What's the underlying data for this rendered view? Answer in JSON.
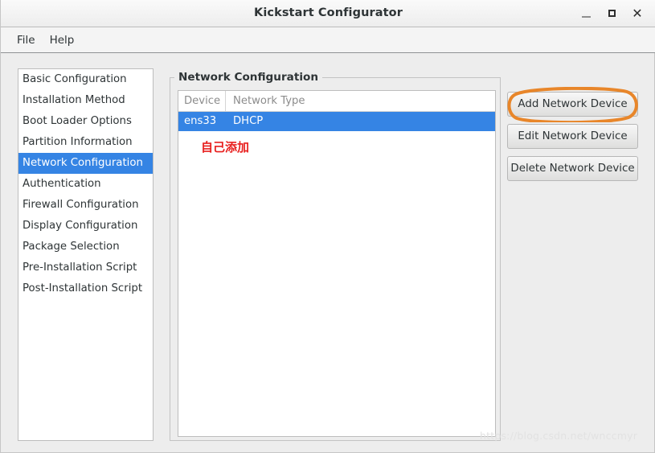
{
  "window": {
    "title": "Kickstart Configurator",
    "controls": {
      "minimize": "minimize-icon",
      "maximize": "maximize-icon",
      "close": "close-icon"
    }
  },
  "menubar": {
    "items": [
      {
        "label": "File"
      },
      {
        "label": "Help"
      }
    ]
  },
  "sidebar": {
    "items": [
      {
        "label": "Basic Configuration",
        "selected": false
      },
      {
        "label": "Installation Method",
        "selected": false
      },
      {
        "label": "Boot Loader Options",
        "selected": false
      },
      {
        "label": "Partition Information",
        "selected": false
      },
      {
        "label": "Network Configuration",
        "selected": true
      },
      {
        "label": "Authentication",
        "selected": false
      },
      {
        "label": "Firewall Configuration",
        "selected": false
      },
      {
        "label": "Display Configuration",
        "selected": false
      },
      {
        "label": "Package Selection",
        "selected": false
      },
      {
        "label": "Pre-Installation Script",
        "selected": false
      },
      {
        "label": "Post-Installation Script",
        "selected": false
      }
    ]
  },
  "main": {
    "group_title": "Network Configuration",
    "table": {
      "columns": [
        "Device",
        "Network Type"
      ],
      "rows": [
        {
          "device": "ens33",
          "network_type": "DHCP",
          "selected": true
        }
      ]
    },
    "annotation": "自己添加",
    "buttons": [
      {
        "label": "Add Network Device",
        "highlighted": true
      },
      {
        "label": "Edit Network Device",
        "highlighted": false
      },
      {
        "label": "Delete Network Device",
        "highlighted": false
      }
    ]
  },
  "watermark": "https://blog.csdn.net/wnccmyr",
  "colors": {
    "selection_blue": "#3584e4",
    "annotation_red": "#e8201f",
    "highlight_orange": "#e8862a",
    "window_background": "#ededed"
  }
}
